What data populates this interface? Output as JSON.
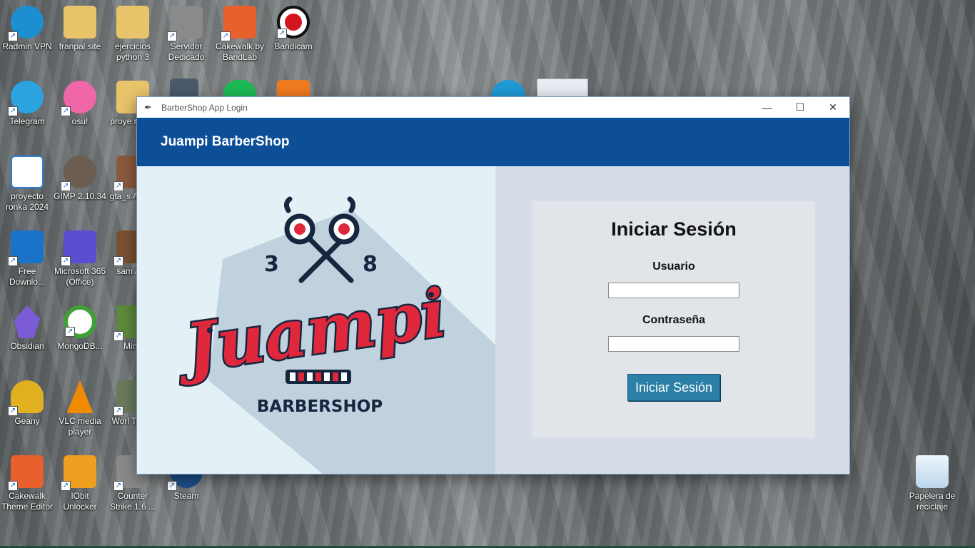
{
  "desktop": {
    "icons": [
      {
        "label": "Radmin VPN",
        "icon": "radmin-vpn-icon",
        "color": "#1c8fd1"
      },
      {
        "label": "franpal site",
        "icon": "folder-icon",
        "color": "#e8c56a"
      },
      {
        "label": "ejercicios python 3",
        "icon": "folder-icon",
        "color": "#e8c56a"
      },
      {
        "label": "Servidor Dedicado",
        "icon": "counter-strike-icon",
        "color": "#8a8a8a"
      },
      {
        "label": "Cakewalk by BandLab",
        "icon": "cakewalk-icon",
        "color": "#e8602c"
      },
      {
        "label": "Bandicam",
        "icon": "bandicam-icon",
        "color": "#d4171e"
      },
      {
        "label": "Telegram",
        "icon": "telegram-icon",
        "color": "#2aa3df"
      },
      {
        "label": "osu!",
        "icon": "osu-icon",
        "color": "#f067a8"
      },
      {
        "label": "proye ronka",
        "icon": "folder-icon",
        "color": "#e8c56a"
      },
      {
        "label": "proyecto ronka 2024",
        "icon": "document-icon",
        "color": "#2b7cd3"
      },
      {
        "label": "GIMP 2.10.34",
        "icon": "gimp-icon",
        "color": "#6b5d4f"
      },
      {
        "label": "gta_s Acces",
        "icon": "gta-icon",
        "color": "#8b5a3c"
      },
      {
        "label": "Free Downlo...",
        "icon": "free-download-icon",
        "color": "#1a73c9"
      },
      {
        "label": "Microsoft 365 (Office)",
        "icon": "microsoft-365-icon",
        "color": "#5a4fd0"
      },
      {
        "label": "sam Acc",
        "icon": "samp-icon",
        "color": "#7a5030"
      },
      {
        "label": "Obsidian",
        "icon": "obsidian-icon",
        "color": "#7c5bd6"
      },
      {
        "label": "MongoDB...",
        "icon": "mongodb-icon",
        "color": "#3fa037"
      },
      {
        "label": "Mine",
        "icon": "minecraft-icon",
        "color": "#5d8a3a"
      },
      {
        "label": "Geany",
        "icon": "geany-icon",
        "color": "#e0b020"
      },
      {
        "label": "VLC media player",
        "icon": "vlc-icon",
        "color": "#f08a00"
      },
      {
        "label": "Worl Tanks",
        "icon": "world-of-tanks-icon",
        "color": "#6a7a5a"
      },
      {
        "label": "Cakewalk Theme Editor",
        "icon": "cakewalk-theme-editor-icon",
        "color": "#e8602c"
      },
      {
        "label": "IObit Unlocker",
        "icon": "iobit-unlocker-icon",
        "color": "#f0a020"
      },
      {
        "label": "Counter Strike 1.6 ...",
        "icon": "counter-strike-icon",
        "color": "#8a8a8a"
      },
      {
        "label": "Steam",
        "icon": "steam-icon",
        "color": "#1b4f8a"
      },
      {
        "label": "Papelera de reciclaje",
        "icon": "recycle-bin-icon",
        "color": "#cfe4f5"
      }
    ]
  },
  "window": {
    "title": "BarberShop App Login",
    "minimize_glyph": "—",
    "maximize_glyph": "☐",
    "close_glyph": "✕"
  },
  "app": {
    "header_title": "Juampi BarberShop",
    "logo": {
      "number_left": "3",
      "number_right": "8",
      "wordmark": "Juampi",
      "subtitle": "BARBERSHOP",
      "accent_color": "#e0283c",
      "navy_color": "#16263f"
    },
    "login": {
      "title": "Iniciar Sesión",
      "username_label": "Usuario",
      "password_label": "Contraseña",
      "username_value": "",
      "password_value": "",
      "submit_label": "Iniciar Sesión"
    }
  },
  "colors": {
    "header_bg": "#0d4f97",
    "button_bg": "#2c7fa6",
    "right_pane_bg": "#d5dde8",
    "card_bg": "#e1e4e8"
  }
}
